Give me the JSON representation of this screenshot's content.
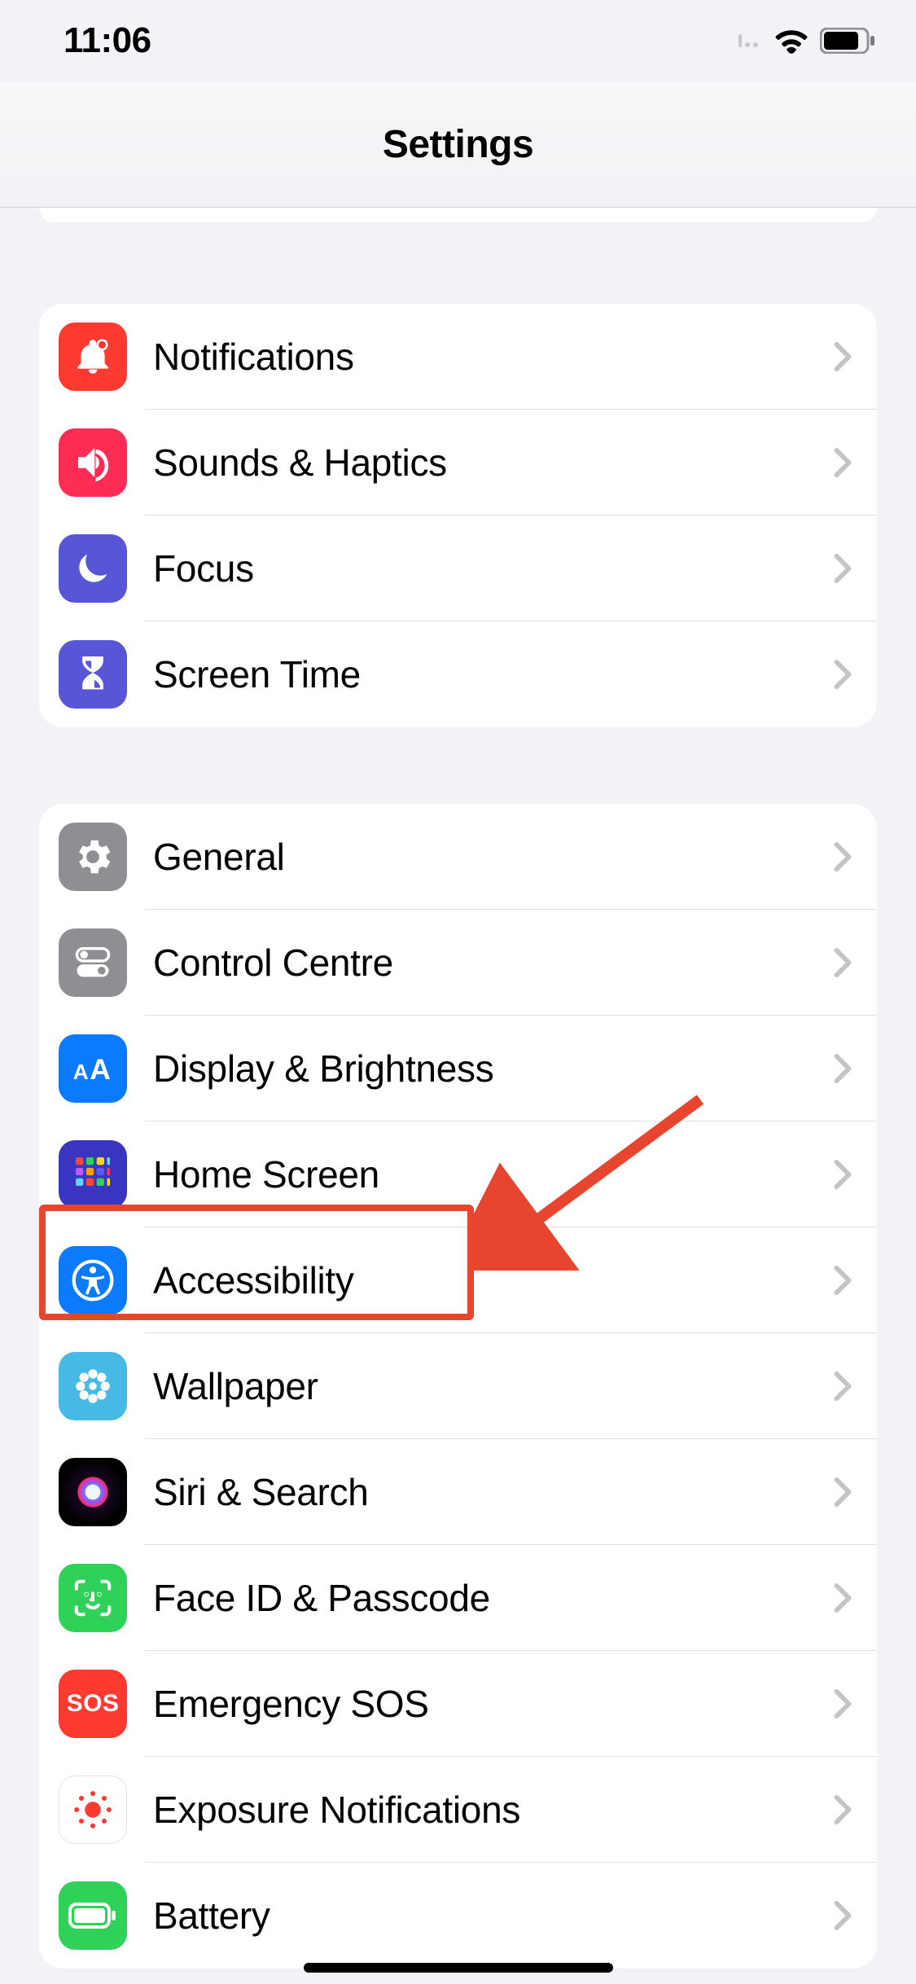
{
  "status": {
    "time": "11:06"
  },
  "header": {
    "title": "Settings"
  },
  "groups": [
    {
      "id": "sounds-focus",
      "rows": [
        {
          "key": "notifications",
          "label": "Notifications",
          "icon": "bell-badge-icon",
          "color": "#ff3a30"
        },
        {
          "key": "sounds-haptics",
          "label": "Sounds & Haptics",
          "icon": "speaker-icon",
          "color": "#ff2d55"
        },
        {
          "key": "focus",
          "label": "Focus",
          "icon": "moon-icon",
          "color": "#5856d6"
        },
        {
          "key": "screen-time",
          "label": "Screen Time",
          "icon": "hourglass-icon",
          "color": "#5856d6"
        }
      ]
    },
    {
      "id": "general",
      "rows": [
        {
          "key": "general",
          "label": "General",
          "icon": "gear-icon",
          "color": "#8e8e93"
        },
        {
          "key": "control-centre",
          "label": "Control Centre",
          "icon": "toggles-icon",
          "color": "#8e8e93"
        },
        {
          "key": "display-brightness",
          "label": "Display & Brightness",
          "icon": "text-size-icon",
          "color": "#0a7aff"
        },
        {
          "key": "home-screen",
          "label": "Home Screen",
          "icon": "app-grid-icon",
          "color": "#4341ca"
        },
        {
          "key": "accessibility",
          "label": "Accessibility",
          "icon": "accessibility-icon",
          "color": "#0a7aff",
          "highlighted": true
        },
        {
          "key": "wallpaper",
          "label": "Wallpaper",
          "icon": "flower-icon",
          "color": "#46b9e5"
        },
        {
          "key": "siri-search",
          "label": "Siri & Search",
          "icon": "siri-icon",
          "color": "#1d1d1f"
        },
        {
          "key": "faceid-passcode",
          "label": "Face ID & Passcode",
          "icon": "faceid-icon",
          "color": "#30d158"
        },
        {
          "key": "emergency-sos",
          "label": "Emergency SOS",
          "icon": "sos-icon",
          "color": "#ff3a30",
          "icon_text": "SOS"
        },
        {
          "key": "exposure-notifications",
          "label": "Exposure Notifications",
          "icon": "exposure-icon",
          "color": "#ffffff"
        },
        {
          "key": "battery",
          "label": "Battery",
          "icon": "battery-icon",
          "color": "#30d158"
        }
      ]
    }
  ]
}
